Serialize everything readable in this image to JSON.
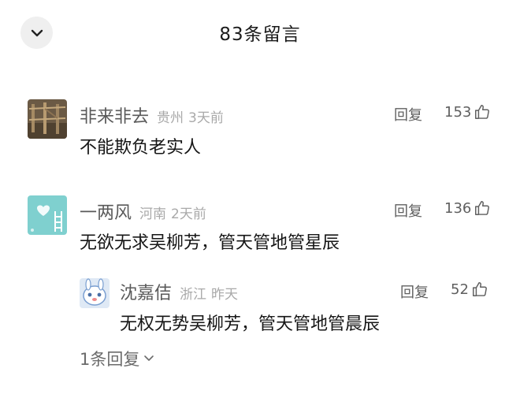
{
  "header": {
    "title": "83条留言"
  },
  "comments": [
    {
      "username": "非来非去",
      "location": "贵州",
      "time": "3天前",
      "reply_label": "回复",
      "likes": "153",
      "text": "不能欺负老实人"
    },
    {
      "username": "一两风",
      "location": "河南",
      "time": "2天前",
      "reply_label": "回复",
      "likes": "136",
      "text": "无欲无求吴柳芳，管天管地管星辰",
      "replies": [
        {
          "username": "沈嘉佶",
          "location": "浙江",
          "time": "昨天",
          "reply_label": "回复",
          "likes": "52",
          "text": "无权无势吴柳芳，管天管地管晨辰"
        }
      ],
      "more_replies_label": "1条回复"
    }
  ],
  "colors": {
    "username": "#5a5a5a",
    "meta": "#a9a9a9",
    "text": "#161616",
    "button_bg": "#efefef"
  }
}
